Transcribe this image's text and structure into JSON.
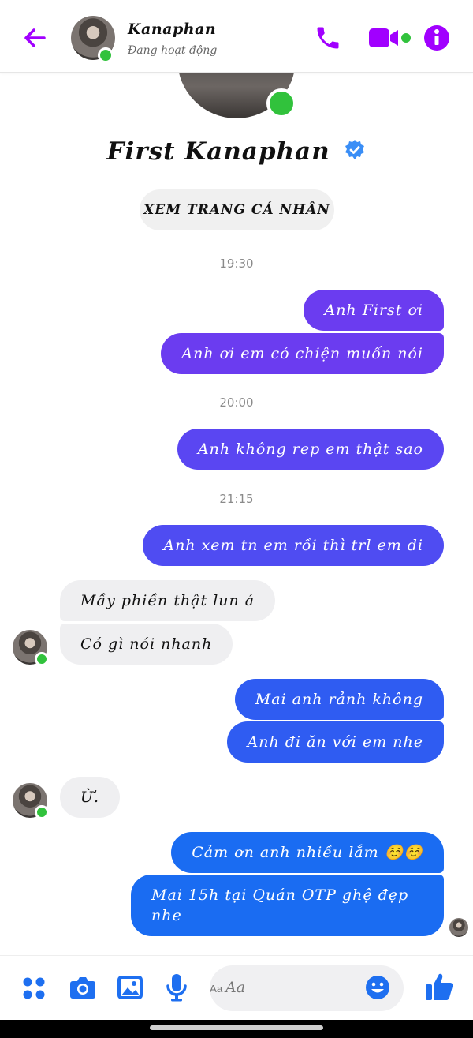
{
  "header": {
    "name": "Kanaphan",
    "status": "Đang hoạt động"
  },
  "profile": {
    "name": "First Kanaphan",
    "view_profile": "XEM TRANG CÁ NHÂN"
  },
  "timestamps": [
    "19:30",
    "20:00",
    "21:15"
  ],
  "messages": {
    "m1": "Anh First ơi",
    "m2": "Anh ơi em có chiện muốn nói",
    "m3": "Anh không rep em thật sao",
    "m4": "Anh xem tn em rồi thì trl em đi",
    "r1": "Mầy phiền thật lun á",
    "r2": "Có gì nói nhanh",
    "m5": "Mai anh rảnh không",
    "m6": "Anh đi ăn với em nhe",
    "r3": "Ừ.",
    "m7": "Cảm ơn anh nhiều lắm ☺️☺️",
    "m8a": "Mai 15h tại Quán OTP ghệ đẹp",
    "m8b": "nhe"
  },
  "composer": {
    "placeholder": "Aa"
  },
  "colors": {
    "accent": "#a100ff",
    "online": "#31c23c",
    "bubble_purple": "#6b3cf0",
    "bubble_blue": "#1a6cf2",
    "verified": "#3a8ef6"
  },
  "icons": [
    "back-arrow-icon",
    "phone-icon",
    "video-icon",
    "info-icon",
    "verified-badge-icon",
    "apps-icon",
    "camera-icon",
    "image-icon",
    "microphone-icon",
    "emoji-icon",
    "like-icon"
  ]
}
